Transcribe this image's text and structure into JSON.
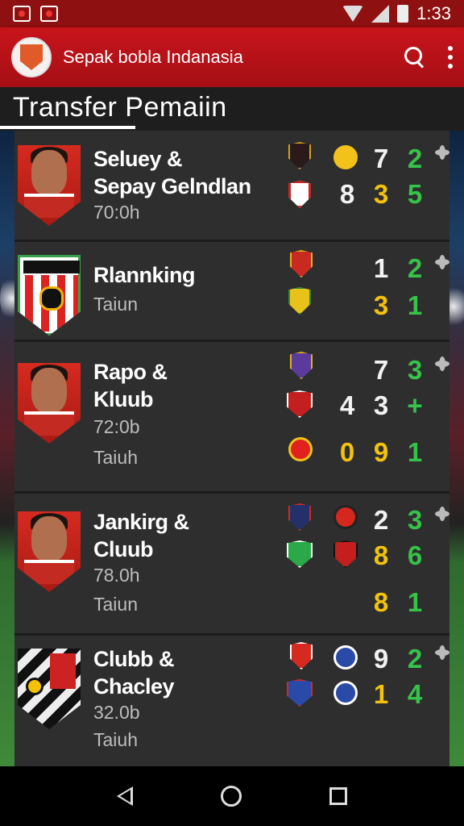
{
  "status_bar": {
    "time": "1:33"
  },
  "app_bar": {
    "title": "Sepak bobla Indanasia"
  },
  "section": {
    "title": "Transfer  Pemaiin"
  },
  "rows": [
    {
      "name_line1": "Seluey &",
      "name_line2": "Sepay Gelndlan",
      "sub1": "70:0h",
      "sub2": "",
      "badges": [
        {
          "icon": "crest-badge-black-gold",
          "color": "#2a1a1a"
        },
        {
          "icon": "crest-badge-yellow-round",
          "color": "#f2c21a"
        },
        {
          "icon": "crest-badge-white-red",
          "color": "#fff"
        }
      ],
      "numbers": [
        [
          "7",
          "2"
        ],
        [
          "8",
          "3",
          "5"
        ]
      ]
    },
    {
      "name_line1": "Rlannking",
      "name_line2": "",
      "sub1": "Taiun",
      "sub2": "",
      "badges": [
        {
          "icon": "crest-badge-red-gold",
          "color": "#c82a20"
        },
        {
          "icon": "crest-badge-yellow-green",
          "color": "#e7c21a"
        }
      ],
      "numbers": [
        [
          "1",
          "2"
        ],
        [
          "3",
          "1"
        ]
      ]
    },
    {
      "name_line1": "Rapo &",
      "name_line2": "Kluub",
      "sub1": "72:0b",
      "sub2": "Taiuh",
      "badges": [
        {
          "icon": "crest-badge-purple",
          "color": "#5a3a9a"
        },
        {
          "icon": "crest-badge-red-white",
          "color": "#c41f1f"
        },
        {
          "icon": "crest-badge-red-yellow-round",
          "color": "#e12020"
        }
      ],
      "numbers": [
        [
          "7",
          "3"
        ],
        [
          "4",
          "3",
          "+"
        ],
        [
          "0",
          "9",
          "1"
        ]
      ]
    },
    {
      "name_line1": "Jankirg &",
      "name_line2": "Cluub",
      "sub1": "78.0h",
      "sub2": "Taiun",
      "badges": [
        {
          "icon": "crest-badge-navy-red",
          "color": "#23306a"
        },
        {
          "icon": "crest-badge-red-round",
          "color": "#d4281f"
        },
        {
          "icon": "crest-badge-green-white",
          "color": "#2aa84a"
        },
        {
          "icon": "crest-badge-red-black",
          "color": "#c41e1e"
        }
      ],
      "numbers": [
        [
          "2",
          "3"
        ],
        [
          "8",
          "6"
        ],
        [
          "8",
          "1"
        ]
      ]
    },
    {
      "name_line1": "Clubb &",
      "name_line2": "Chacley",
      "sub1": "32.0b",
      "sub2": "Taiuh",
      "badges": [
        {
          "icon": "crest-badge-red-white-2",
          "color": "#d42a20"
        },
        {
          "icon": "crest-badge-blue-round",
          "color": "#2a4aa8"
        },
        {
          "icon": "crest-badge-blue-red",
          "color": "#2a4aa8"
        },
        {
          "icon": "crest-badge-blue-round-2",
          "color": "#2a4aa8"
        }
      ],
      "numbers": [
        [
          "9",
          "2"
        ],
        [
          "1",
          "4"
        ]
      ]
    }
  ],
  "nav": {
    "back_icon": "back-icon",
    "home_icon": "home-icon",
    "recents_icon": "recents-icon"
  }
}
